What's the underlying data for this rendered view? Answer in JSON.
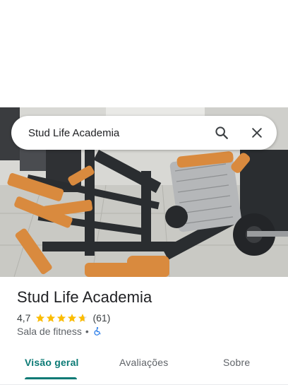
{
  "search": {
    "query": "Stud Life Academia"
  },
  "place": {
    "name": "Stud Life Academia",
    "rating": "4,7",
    "rating_value": 4.7,
    "review_count": "(61)",
    "category": "Sala de fitness",
    "separator": "•"
  },
  "tabs": [
    {
      "label": "Visão geral",
      "active": true
    },
    {
      "label": "Avaliações",
      "active": false
    },
    {
      "label": "Sobre",
      "active": false
    }
  ],
  "icons": {
    "search": "search-icon",
    "close": "close-icon",
    "star": "star-icon",
    "accessibility": "wheelchair-icon"
  },
  "colors": {
    "accent": "#0b7a75",
    "star": "#fbbc04",
    "machine_orange": "#d98a3e",
    "machine_frame": "#2a2d30",
    "wheelchair": "#1a73e8"
  }
}
